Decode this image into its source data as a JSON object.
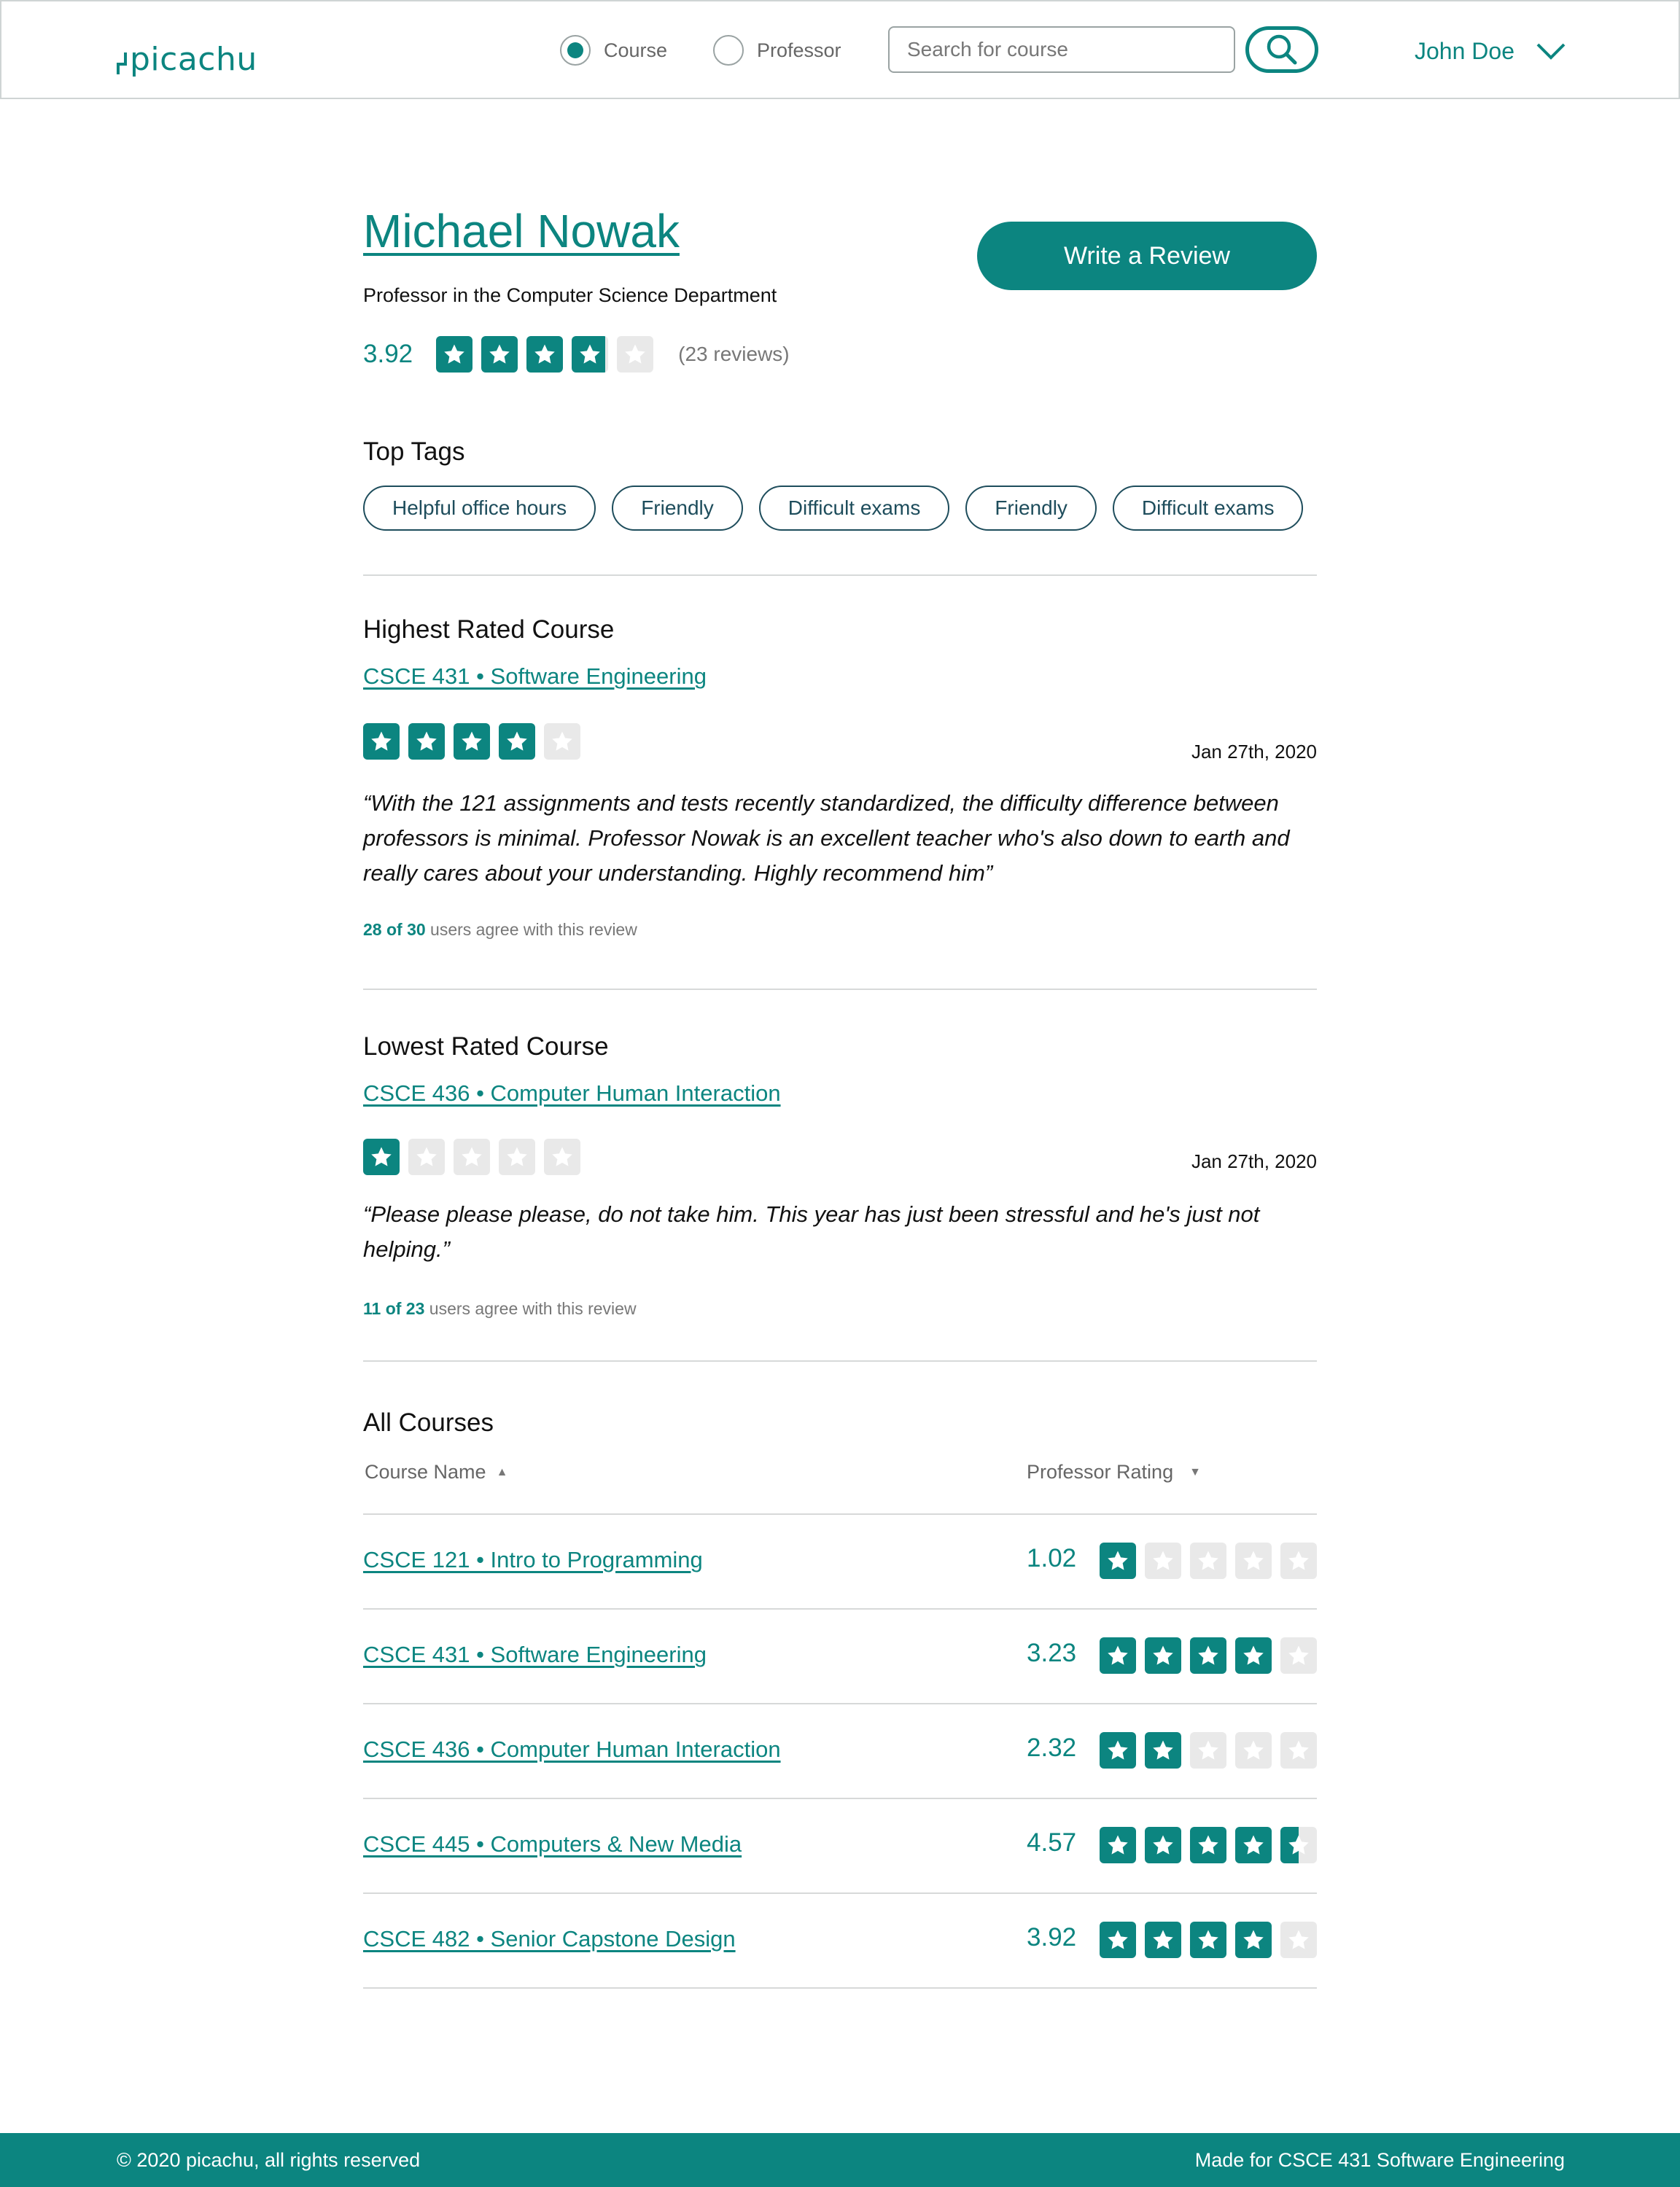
{
  "header": {
    "logo_text": "picachu",
    "search_mode": {
      "options": [
        {
          "label": "Course",
          "checked": true
        },
        {
          "label": "Professor",
          "checked": false
        }
      ]
    },
    "search_placeholder": "Search for course",
    "search_icon": "search-icon",
    "user_name": "John Doe",
    "user_menu_icon": "chevron-down-icon"
  },
  "professor": {
    "name": "Michael Nowak",
    "department": "Professor in the Computer Science Department",
    "rating": "3.92",
    "rating_value": 3.92,
    "reviews": "(23 reviews)",
    "write_review_label": "Write a Review"
  },
  "top_tags": {
    "title": "Top Tags",
    "tags": [
      "Helpful office hours",
      "Friendly",
      "Difficult exams",
      "Friendly",
      "Difficult exams"
    ]
  },
  "highest_rated": {
    "title": "Highest Rated Course",
    "course": "CSCE 431 • Software Engineering",
    "stars": 4,
    "date": "Jan 27th, 2020",
    "text": "“With the 121 assignments and tests recently standardized, the difficulty difference between professors is minimal. Professor Nowak is an excellent teacher who's also down to earth and really cares about your understanding. Highly recommend him”",
    "agree_count": "28 of 30",
    "agree_suffix": " users agree with this review"
  },
  "lowest_rated": {
    "title": "Lowest Rated Course",
    "course": "CSCE 436 • Computer Human Interaction",
    "stars": 1,
    "date": "Jan 27th, 2020",
    "text": "“Please please please, do not take him. This year has just been stressful and he's just not helping.”",
    "agree_count": "11 of 23",
    "agree_suffix": " users agree with this review"
  },
  "all_courses": {
    "title": "All Courses",
    "columns": [
      "Course Name",
      "Professor Rating"
    ],
    "sort_icons": [
      "sort-up-icon",
      "sort-down-icon"
    ],
    "rows": [
      {
        "name": "CSCE 121 • Intro to Programming",
        "score": "1.02",
        "stars": 1
      },
      {
        "name": "CSCE 431 • Software Engineering",
        "score": "3.23",
        "stars": 4
      },
      {
        "name": "CSCE 436 • Computer Human Interaction",
        "score": "2.32",
        "stars": 2
      },
      {
        "name": "CSCE 445 • Computers & New Media",
        "score": "4.57",
        "stars": 4.5
      },
      {
        "name": "CSCE 482 • Senior Capstone Design",
        "score": "3.92",
        "stars": 4
      }
    ]
  },
  "footer": {
    "copyright": "© 2020 picachu,  all rights reserved",
    "made_for": "Made for CSCE 431 Software Engineering"
  },
  "colors": {
    "accent": "#0c8580",
    "star_empty": "#e9e9e9",
    "tag_border": "#1e4d5c"
  }
}
